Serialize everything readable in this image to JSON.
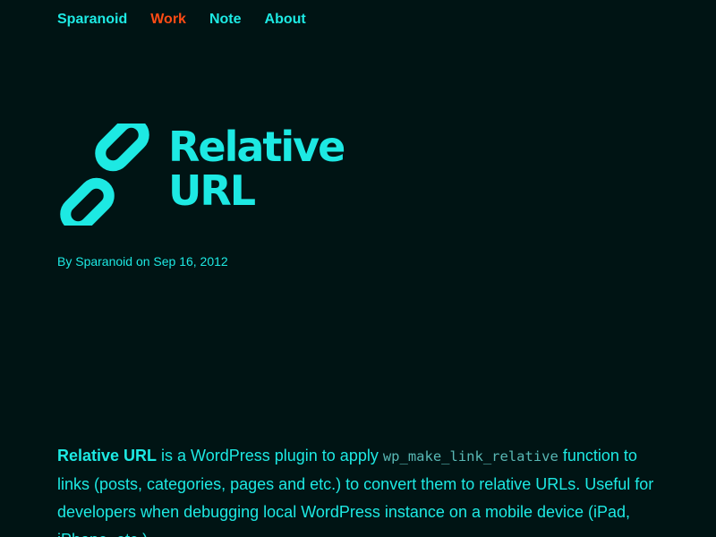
{
  "nav": {
    "items": [
      {
        "label": "Sparanoid",
        "active": false
      },
      {
        "label": "Work",
        "active": true
      },
      {
        "label": "Note",
        "active": false
      },
      {
        "label": "About",
        "active": false
      }
    ]
  },
  "hero": {
    "logo_icon": "chain-link-icon",
    "title_line1": "Relative",
    "title_line2": "URL"
  },
  "byline": "By Sparanoid on Sep 16, 2012",
  "content": {
    "name": "Relative URL",
    "text1": " is a WordPress plugin to apply ",
    "code": "wp_make_link_relative",
    "text2": " function to links (posts, categories, pages and etc.) to convert them to relative URLs. Useful for developers when debugging local WordPress instance on a mobile device (iPad, iPhone, etc.)."
  },
  "colors": {
    "background": "#001414",
    "accent": "#1de9e3",
    "active": "#ff4b14",
    "code": "#58b8b5"
  }
}
